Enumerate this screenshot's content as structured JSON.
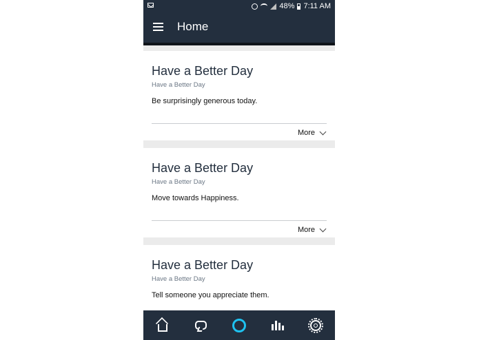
{
  "status": {
    "battery": "48%",
    "time": "7:11 AM"
  },
  "appbar": {
    "title": "Home"
  },
  "cards": [
    {
      "title": "Have a Better Day",
      "subtitle": "Have a Better Day",
      "body": "Be surprisingly generous today.",
      "more": "More"
    },
    {
      "title": "Have a Better Day",
      "subtitle": "Have a Better Day",
      "body": "Move towards Happiness.",
      "more": "More"
    },
    {
      "title": "Have a Better Day",
      "subtitle": "Have a Better Day",
      "body": "Tell someone you appreciate them."
    }
  ],
  "icons": {
    "menu": "menu-icon",
    "home": "home-icon",
    "chat": "chat-icon",
    "alexa": "alexa-icon",
    "music": "music-icon",
    "settings": "gear-icon"
  },
  "colors": {
    "bar": "#232f3e",
    "accent": "#1ec2f0",
    "background": "#ebebeb"
  }
}
